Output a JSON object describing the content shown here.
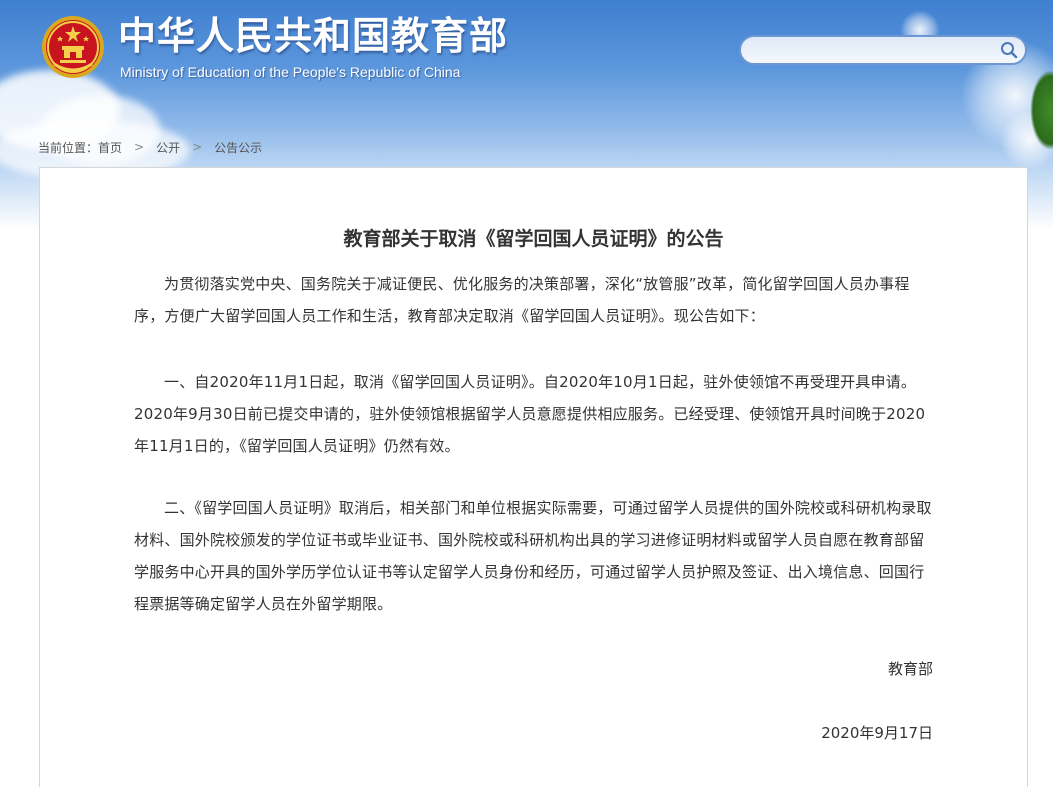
{
  "header": {
    "site_title": "中华人民共和国教育部",
    "site_subtitle": "Ministry of Education of the People's Republic of China",
    "emblem_icon": "national-emblem-icon",
    "search": {
      "value": "",
      "icon": "search-icon"
    }
  },
  "breadcrumb": {
    "prefix": "当前位置：",
    "items": [
      "首页",
      "公开",
      "公告公示"
    ],
    "separator": ">"
  },
  "article": {
    "title": "教育部关于取消《留学回国人员证明》的公告",
    "paragraphs": [
      "为贯彻落实党中央、国务院关于减证便民、优化服务的决策部署，深化“放管服”改革，简化留学回国人员办事程序，方便广大留学回国人员工作和生活，教育部决定取消《留学回国人员证明》。现公告如下：",
      "一、自2020年11月1日起，取消《留学回国人员证明》。自2020年10月1日起，驻外使领馆不再受理开具申请。2020年9月30日前已提交申请的，驻外使领馆根据留学人员意愿提供相应服务。已经受理、使领馆开具时间晚于2020年11月1日的，《留学回国人员证明》仍然有效。",
      "二、《留学回国人员证明》取消后，相关部门和单位根据实际需要，可通过留学人员提供的国外院校或科研机构录取材料、国外院校颁发的学位证书或毕业证书、国外院校或科研机构出具的学习进修证明材料或留学人员自愿在教育部留学服务中心开具的国外学历学位认证书等认定留学人员身份和经历，可通过留学人员护照及签证、出入境信息、回国行程票据等确定留学人员在外留学期限。"
    ],
    "signature": "教育部",
    "date": "2020年9月17日"
  },
  "colors": {
    "banner_top": "#3f7fd0",
    "text": "#333333",
    "search_border": "#6d97d4"
  }
}
